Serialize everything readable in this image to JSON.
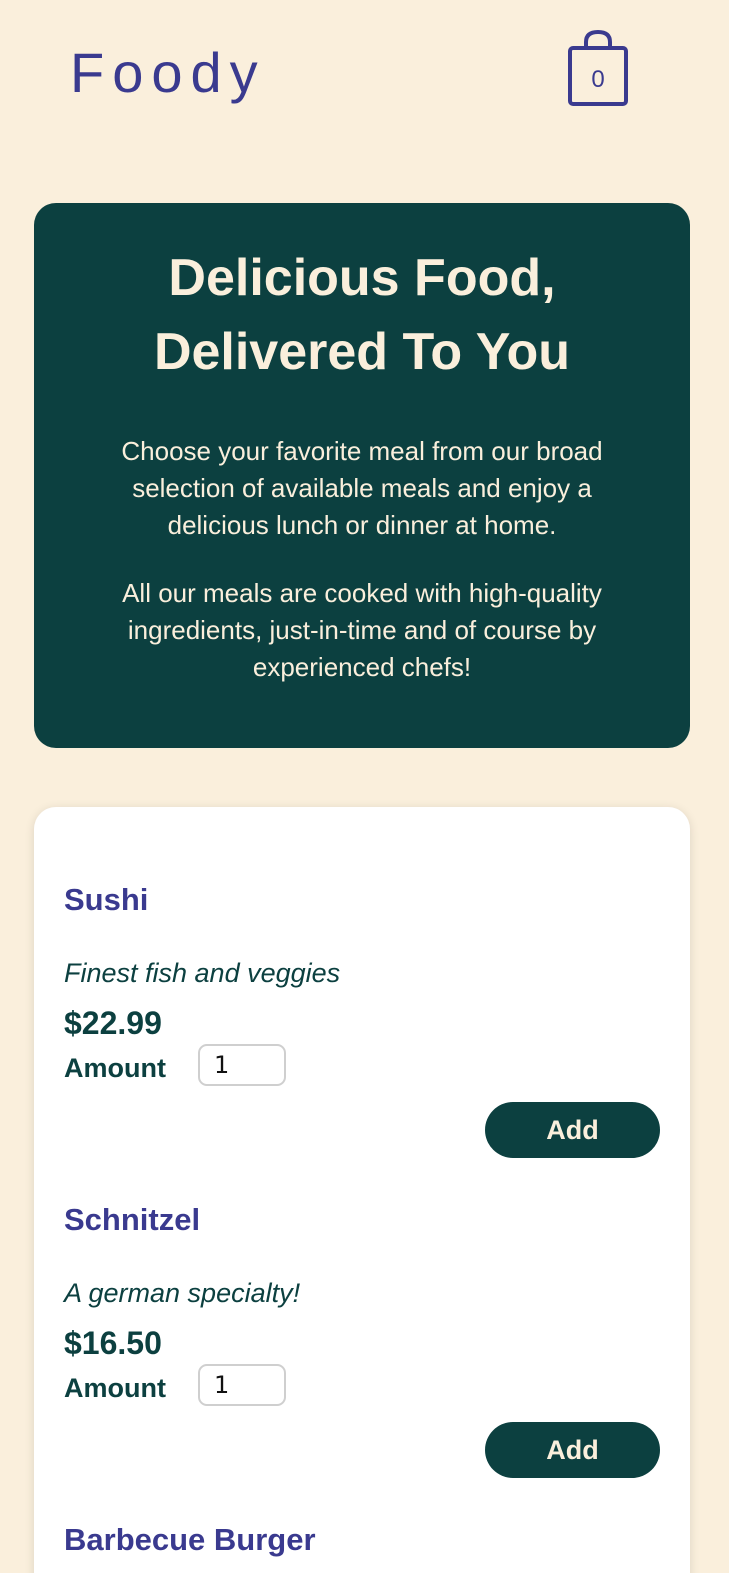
{
  "header": {
    "logo": "Foody",
    "cart_count": "0",
    "cart_icon": "shopping-bag-icon"
  },
  "hero": {
    "title": "Delicious Food, Delivered To You",
    "paragraph1": "Choose your favorite meal from our broad selection of available meals and enjoy a delicious lunch or dinner at home.",
    "paragraph2": "All our meals are cooked with high-quality ingredients, just-in-time and of course by experienced chefs!"
  },
  "meals": [
    {
      "name": "Sushi",
      "description": "Finest fish and veggies",
      "price": "$22.99",
      "amount_label": "Amount",
      "amount_value": "1",
      "add_label": "Add"
    },
    {
      "name": "Schnitzel",
      "description": "A german specialty!",
      "price": "$16.50",
      "amount_label": "Amount",
      "amount_value": "1",
      "add_label": "Add"
    },
    {
      "name": "Barbecue Burger"
    }
  ],
  "colors": {
    "background": "#faefdc",
    "primary_dark": "#0c4040",
    "accent": "#3a3a8f",
    "card": "#ffffff"
  }
}
